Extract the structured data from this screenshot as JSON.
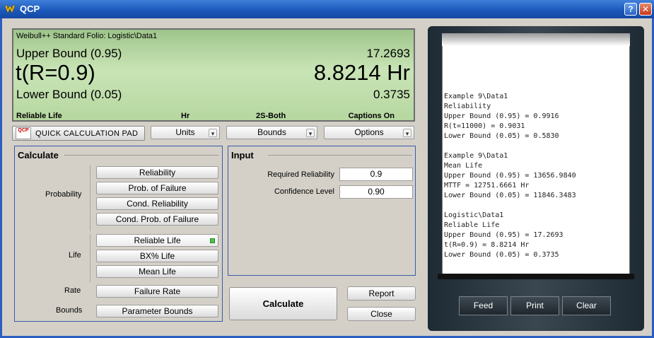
{
  "window": {
    "title": "QCP"
  },
  "display": {
    "folio": "Weibull++ Standard Folio: Logistic\\Data1",
    "upper_label": "Upper Bound (0.95)",
    "upper_value": "17.2693",
    "main_label": "t(R=0.9)",
    "main_value": "8.8214 Hr",
    "lower_label": "Lower Bound (0.05)",
    "lower_value": "0.3735",
    "status": [
      "Reliable Life",
      "Hr",
      "2S-Both",
      "Captions On"
    ]
  },
  "toolbar": {
    "qcp_label": "QUICK CALCULATION PAD",
    "qcp_icon_text": "QCP",
    "units": "Units",
    "bounds": "Bounds",
    "options": "Options"
  },
  "calculate": {
    "title": "Calculate",
    "probability_label": "Probability",
    "life_label": "Life",
    "rate_label": "Rate",
    "bounds_label": "Bounds",
    "buttons": {
      "reliability": "Reliability",
      "prob_failure": "Prob. of Failure",
      "cond_reliability": "Cond. Reliability",
      "cond_prob_failure": "Cond. Prob. of Failure",
      "reliable_life": "Reliable Life",
      "bx_life": "BX% Life",
      "mean_life": "Mean Life",
      "failure_rate": "Failure Rate",
      "parameter_bounds": "Parameter Bounds"
    }
  },
  "input": {
    "title": "Input",
    "required_reliability_label": "Required Reliability",
    "required_reliability_value": "0.9",
    "confidence_level_label": "Confidence Level",
    "confidence_level_value": "0.90"
  },
  "actions": {
    "calculate": "Calculate",
    "report": "Report",
    "close": "Close"
  },
  "printer": {
    "lines": [
      "Example 9\\Data1",
      "Reliability",
      "Upper Bound (0.95) = 0.9916",
      "R(t=11000) = 0.9031",
      "Lower Bound (0.05) = 0.5830",
      "",
      "Example 9\\Data1",
      "Mean Life",
      "Upper Bound (0.95) = 13656.9840",
      "MTTF = 12751.6661 Hr",
      "Lower Bound (0.05) = 11846.3483",
      "",
      "Logistic\\Data1",
      "Reliable Life",
      "Upper Bound (0.95) = 17.2693",
      "t(R=0.9) = 8.8214 Hr",
      "Lower Bound (0.05) = 0.3735"
    ],
    "feed": "Feed",
    "print": "Print",
    "clear": "Clear"
  }
}
